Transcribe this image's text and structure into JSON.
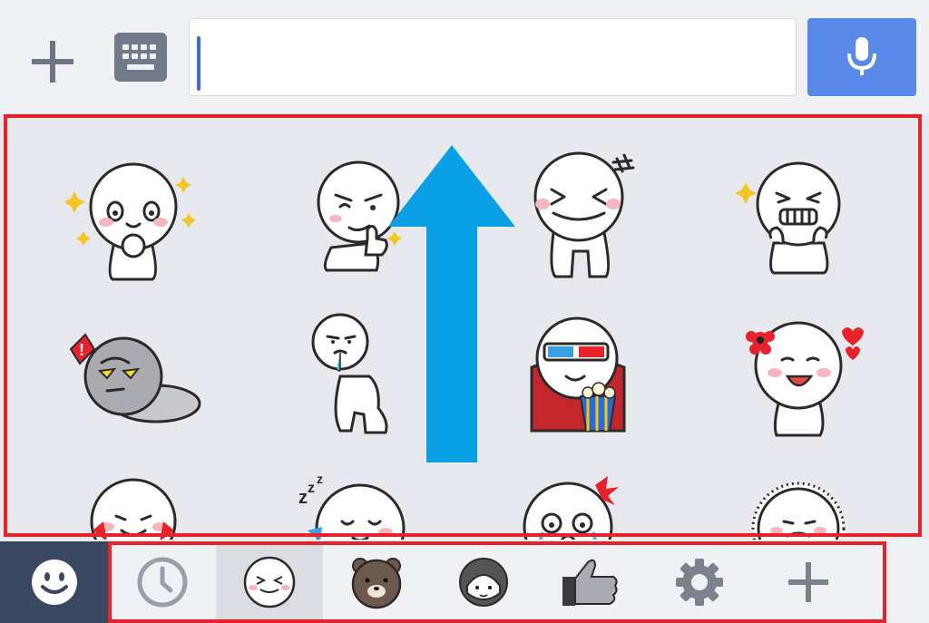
{
  "input": {
    "value": "",
    "placeholder": ""
  },
  "colors": {
    "accent": "#5888e8",
    "highlight_frame": "#e8222b",
    "arrow": "#0aa0e6",
    "emoji_tab_bg": "#3a4761"
  },
  "top_bar": {
    "plus_icon": "plus-icon",
    "keyboard_icon": "keyboard-icon",
    "mic_icon": "microphone-icon"
  },
  "sticker_grid": {
    "scroll_hint": "arrow-up-icon",
    "stickers": [
      {
        "name": "sticker-sparkle-pleading"
      },
      {
        "name": "sticker-thumbs-up-wink"
      },
      {
        "name": "sticker-laughing-squint"
      },
      {
        "name": "sticker-grinning-excited"
      },
      {
        "name": "sticker-angry-shaded"
      },
      {
        "name": "sticker-drooling-walk"
      },
      {
        "name": "sticker-3d-glasses-popcorn"
      },
      {
        "name": "sticker-flower-hearts-happy"
      },
      {
        "name": "sticker-smiling-peek"
      },
      {
        "name": "sticker-sleeping-zzz"
      },
      {
        "name": "sticker-crying-ribbon"
      },
      {
        "name": "sticker-dotted-sad"
      }
    ]
  },
  "bottom_tabs": [
    {
      "name": "emoji-tab",
      "icon": "smiley-icon",
      "active": true
    },
    {
      "name": "recent-tab",
      "icon": "clock-icon",
      "active": false
    },
    {
      "name": "moon-sticker-tab",
      "icon": "moon-face-icon",
      "active": true
    },
    {
      "name": "brown-bear-tab",
      "icon": "bear-icon",
      "active": false
    },
    {
      "name": "girl-sticker-tab",
      "icon": "girl-face-icon",
      "active": false
    },
    {
      "name": "thumbs-up-tab",
      "icon": "thumbs-up-icon",
      "active": false
    },
    {
      "name": "settings-tab",
      "icon": "gear-icon",
      "active": false
    },
    {
      "name": "add-sticker-tab",
      "icon": "plus-icon",
      "active": false
    }
  ]
}
